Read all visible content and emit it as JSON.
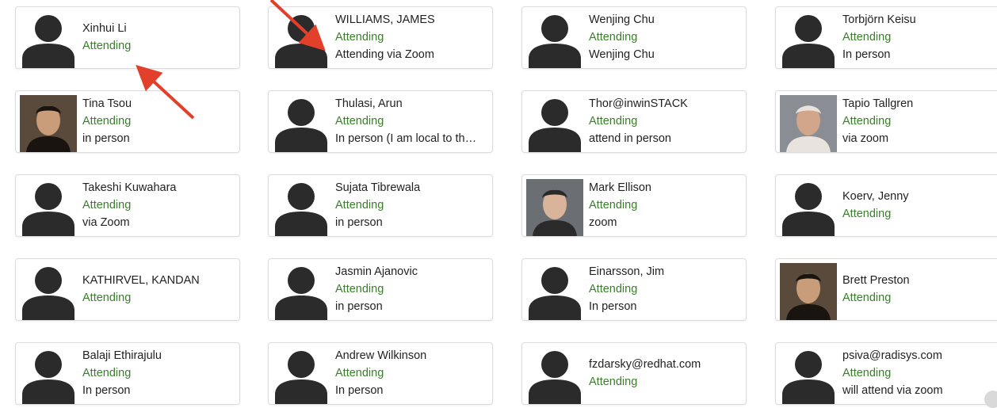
{
  "colors": {
    "status": "#3a7d2b",
    "silhouette": "#2b2b2b",
    "arrow": "#e2402b"
  },
  "attendees": [
    [
      {
        "name": "Xinhui Li",
        "status": "Attending",
        "note": "",
        "avatar": "silhouette"
      },
      {
        "name": "WILLIAMS, JAMES",
        "status": "Attending",
        "note": "Attending via Zoom",
        "avatar": "silhouette"
      },
      {
        "name": "Wenjing Chu",
        "status": "Attending",
        "note": "Wenjing Chu",
        "avatar": "silhouette"
      },
      {
        "name": "Torbjörn Keisu",
        "status": "Attending",
        "note": "In person",
        "avatar": "silhouette"
      }
    ],
    [
      {
        "name": "Tina Tsou",
        "status": "Attending",
        "note": "in person",
        "avatar": "photo"
      },
      {
        "name": "Thulasi, Arun",
        "status": "Attending",
        "note": "In person (I am local to th…",
        "avatar": "silhouette"
      },
      {
        "name": "Thor@inwinSTACK",
        "status": "Attending",
        "note": "attend in person",
        "avatar": "silhouette"
      },
      {
        "name": "Tapio Tallgren",
        "status": "Attending",
        "note": "via zoom",
        "avatar": "photo"
      }
    ],
    [
      {
        "name": "Takeshi Kuwahara",
        "status": "Attending",
        "note": "via Zoom",
        "avatar": "silhouette"
      },
      {
        "name": "Sujata Tibrewala",
        "status": "Attending",
        "note": "in person",
        "avatar": "silhouette"
      },
      {
        "name": "Mark Ellison",
        "status": "Attending",
        "note": "zoom",
        "avatar": "photo"
      },
      {
        "name": "Koerv, Jenny",
        "status": "Attending",
        "note": "",
        "avatar": "silhouette"
      }
    ],
    [
      {
        "name": "KATHIRVEL, KANDAN",
        "status": "Attending",
        "note": "",
        "avatar": "silhouette"
      },
      {
        "name": "Jasmin Ajanovic",
        "status": "Attending",
        "note": "in person",
        "avatar": "silhouette"
      },
      {
        "name": "Einarsson, Jim",
        "status": "Attending",
        "note": "In person",
        "avatar": "silhouette"
      },
      {
        "name": "Brett Preston",
        "status": "Attending",
        "note": "",
        "avatar": "photo"
      }
    ],
    [
      {
        "name": "Balaji Ethirajulu",
        "status": "Attending",
        "note": "In person",
        "avatar": "silhouette"
      },
      {
        "name": "Andrew Wilkinson",
        "status": "Attending",
        "note": "In person",
        "avatar": "silhouette"
      },
      {
        "name": "fzdarsky@redhat.com",
        "status": "Attending",
        "note": "",
        "avatar": "silhouette"
      },
      {
        "name": "psiva@radisys.com",
        "status": "Attending",
        "note": "will attend via zoom",
        "avatar": "silhouette"
      }
    ]
  ]
}
